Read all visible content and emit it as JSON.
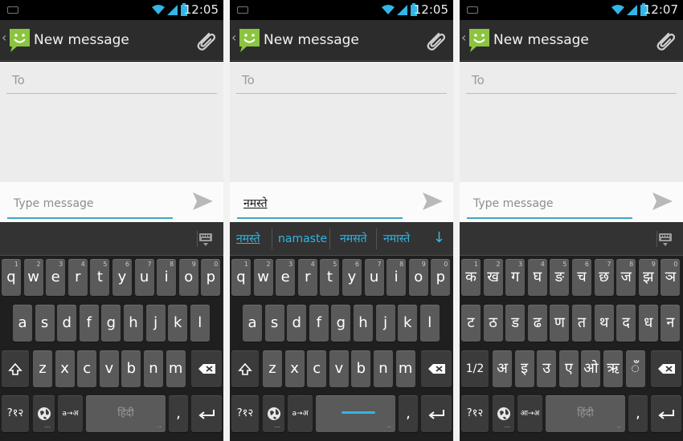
{
  "screens": [
    {
      "time": "12:05",
      "title": "New message",
      "to_label": "To",
      "message_text": "",
      "message_placeholder": "Type message",
      "keyboard_type": "qwerty",
      "suggestions": [],
      "rows": [
        {
          "keys": [
            "q",
            "w",
            "e",
            "r",
            "t",
            "y",
            "u",
            "i",
            "o",
            "p"
          ],
          "hints": [
            "1",
            "2",
            "3",
            "4",
            "5",
            "6",
            "7",
            "8",
            "9",
            "0"
          ]
        },
        {
          "keys": [
            "a",
            "s",
            "d",
            "f",
            "g",
            "h",
            "j",
            "k",
            "l"
          ]
        },
        {
          "keys": [
            "z",
            "x",
            "c",
            "v",
            "b",
            "n",
            "m"
          ],
          "left_key": "shift",
          "right_key": "backspace"
        }
      ],
      "bottom": {
        "symbols": "?१२",
        "globe": "globe",
        "translit": "a→अ",
        "space": "हिंदी",
        "comma": ",",
        "enter": "enter"
      }
    },
    {
      "time": "12:05",
      "title": "New message",
      "to_label": "To",
      "message_text": "नमस्ते",
      "message_placeholder": "Type message",
      "keyboard_type": "qwerty",
      "suggestions": [
        "नमस्ते",
        "namaste",
        "नमसते",
        "नमास्ते"
      ],
      "rows": [
        {
          "keys": [
            "q",
            "w",
            "e",
            "r",
            "t",
            "y",
            "u",
            "i",
            "o",
            "p"
          ],
          "hints": [
            "1",
            "2",
            "3",
            "4",
            "5",
            "6",
            "7",
            "8",
            "9",
            "0"
          ]
        },
        {
          "keys": [
            "a",
            "s",
            "d",
            "f",
            "g",
            "h",
            "j",
            "k",
            "l"
          ]
        },
        {
          "keys": [
            "z",
            "x",
            "c",
            "v",
            "b",
            "n",
            "m"
          ],
          "left_key": "shift",
          "right_key": "backspace"
        }
      ],
      "bottom": {
        "symbols": "?१२",
        "globe": "globe",
        "translit": "a→अ",
        "space": "",
        "comma": ",",
        "enter": "enter"
      }
    },
    {
      "time": "12:07",
      "title": "New message",
      "to_label": "To",
      "message_text": "",
      "message_placeholder": "Type message",
      "keyboard_type": "hindi",
      "suggestions": [],
      "rows": [
        {
          "keys": [
            "क",
            "ख",
            "ग",
            "घ",
            "ङ",
            "च",
            "छ",
            "ज",
            "झ",
            "ञ"
          ],
          "hints": [
            "1",
            "2",
            "3",
            "4",
            "5",
            "6",
            "7",
            "8",
            "9",
            "0"
          ]
        },
        {
          "keys": [
            "ट",
            "ठ",
            "ड",
            "ढ",
            "ण",
            "त",
            "थ",
            "द",
            "ध",
            "न"
          ]
        },
        {
          "keys": [
            "अ",
            "इ",
            "उ",
            "ए",
            "ओ",
            "ऋ",
            "ँ"
          ],
          "left_key": "1/2",
          "right_key": "backspace"
        }
      ],
      "bottom": {
        "symbols": "?१२",
        "globe": "globe",
        "translit": "आ→अ",
        "space": "हिंदी",
        "comma": ",",
        "enter": "enter"
      }
    }
  ],
  "colors": {
    "accent": "#33b5e5",
    "statusbar": "#000000",
    "actionbar": "#2c2c2c",
    "key": "#5a5a5a",
    "key_dark": "#3b3b3b",
    "keyboard_bg": "#1f1f1f",
    "recipient_bg": "#ececec"
  },
  "icons": {
    "app": "messaging-smiley-icon",
    "attach": "paperclip-icon",
    "send": "send-icon",
    "keyboard": "keyboard-icon",
    "signal": "signal-icon",
    "wifi": "wifi-icon",
    "battery": "battery-icon",
    "globe": "globe-icon"
  }
}
